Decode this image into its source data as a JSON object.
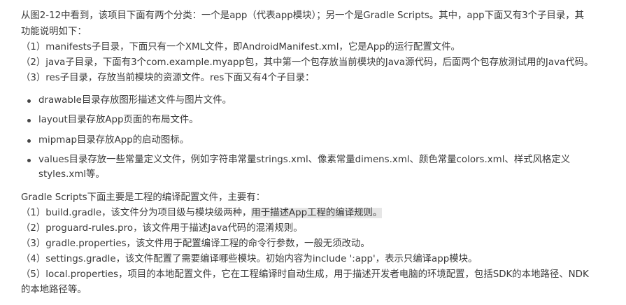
{
  "intro": {
    "line1": "从图2-12中看到，该项目下面有两个分类：一个是app（代表app模块）；另一个是Gradle Scripts。其中，app下面又有3个子目录，其",
    "line2": "功能说明如下："
  },
  "app_dirs": [
    "（1）manifests子目录，下面只有一个XML文件，即AndroidManifest.xml，它是App的运行配置文件。",
    "（2）java子目录，下面有3个com.example.myapp包，其中第一个包存放当前模块的Java源代码，后面两个包存放测试用的Java代码。",
    "（3）res子目录，存放当前模块的资源文件。res下面又有4个子目录："
  ],
  "res_bullets": [
    "drawable目录存放图形描述文件与图片文件。",
    "layout目录存放App页面的布局文件。",
    "mipmap目录存放App的启动图标。",
    "values目录存放一些常量定义文件，例如字符串常量strings.xml、像素常量dimens.xml、颜色常量colors.xml、样式风格定义"
  ],
  "res_bullet_continuation": "styles.xml等。",
  "gradle_intro": "Gradle Scripts下面主要是工程的编译配置文件，主要有：",
  "gradle_item1": {
    "prefix": "（1）build.gradle，该文件分为项目级与模块级两种，",
    "highlighted": "用于描述App工程的编译规则。"
  },
  "gradle_items": [
    "（2）proguard-rules.pro，该文件用于描述Java代码的混淆规则。",
    "（3）gradle.properties，该文件用于配置编译工程的命令行参数，一般无须改动。",
    "（4）settings.gradle，该文件配置了需要编译哪些模块。初始内容为include ':app'，表示只编译app模块。",
    "（5）local.properties，项目的本地配置文件，它在工程编译时自动生成，用于描述开发者电脑的环境配置，包括SDK的本地路径、NDK"
  ],
  "gradle_item5_continuation": "的本地路径等。"
}
